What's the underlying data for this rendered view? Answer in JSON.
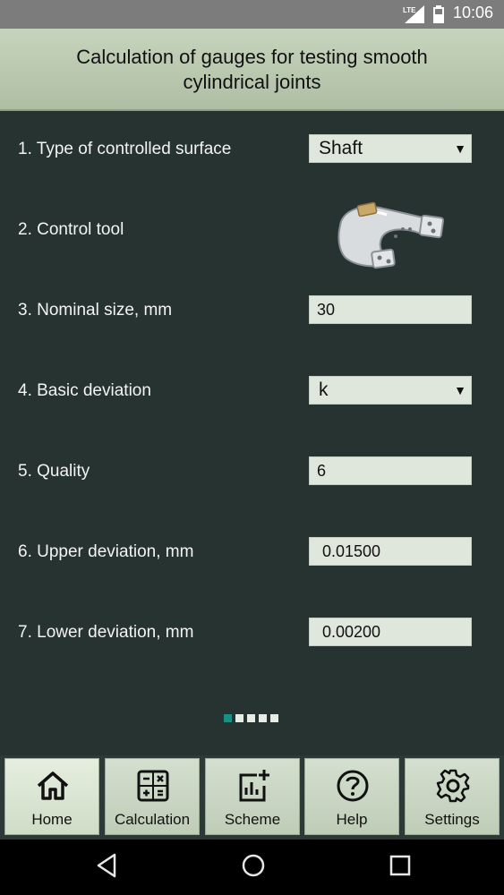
{
  "status_bar": {
    "network": "LTE",
    "time": "10:06"
  },
  "header": {
    "title": "Calculation of gauges for testing smooth cylindrical joints"
  },
  "form": {
    "rows": [
      {
        "label": "1. Type of controlled surface",
        "value": "Shaft"
      },
      {
        "label": "2. Control tool"
      },
      {
        "label": "3. Nominal size, mm",
        "value": "30"
      },
      {
        "label": "4. Basic deviation",
        "value": "k"
      },
      {
        "label": "5. Quality",
        "value": "6"
      },
      {
        "label": "6. Upper deviation, mm",
        "value": "0.01500"
      },
      {
        "label": "7. Lower deviation, mm",
        "value": "0.00200"
      }
    ],
    "caret": "▼"
  },
  "pager": {
    "page": 1,
    "count": 5
  },
  "bottom_nav": {
    "items": [
      {
        "label": "Home",
        "icon": "home-icon"
      },
      {
        "label": "Calculation",
        "icon": "calculator-icon"
      },
      {
        "label": "Scheme",
        "icon": "chart-add-icon"
      },
      {
        "label": "Help",
        "icon": "help-circle-icon"
      },
      {
        "label": "Settings",
        "icon": "gear-icon"
      }
    ]
  },
  "colors": {
    "background": "#263330",
    "header": "#b8c7ad",
    "field": "#dfe6dc",
    "active_dot": "#1b8f83"
  }
}
